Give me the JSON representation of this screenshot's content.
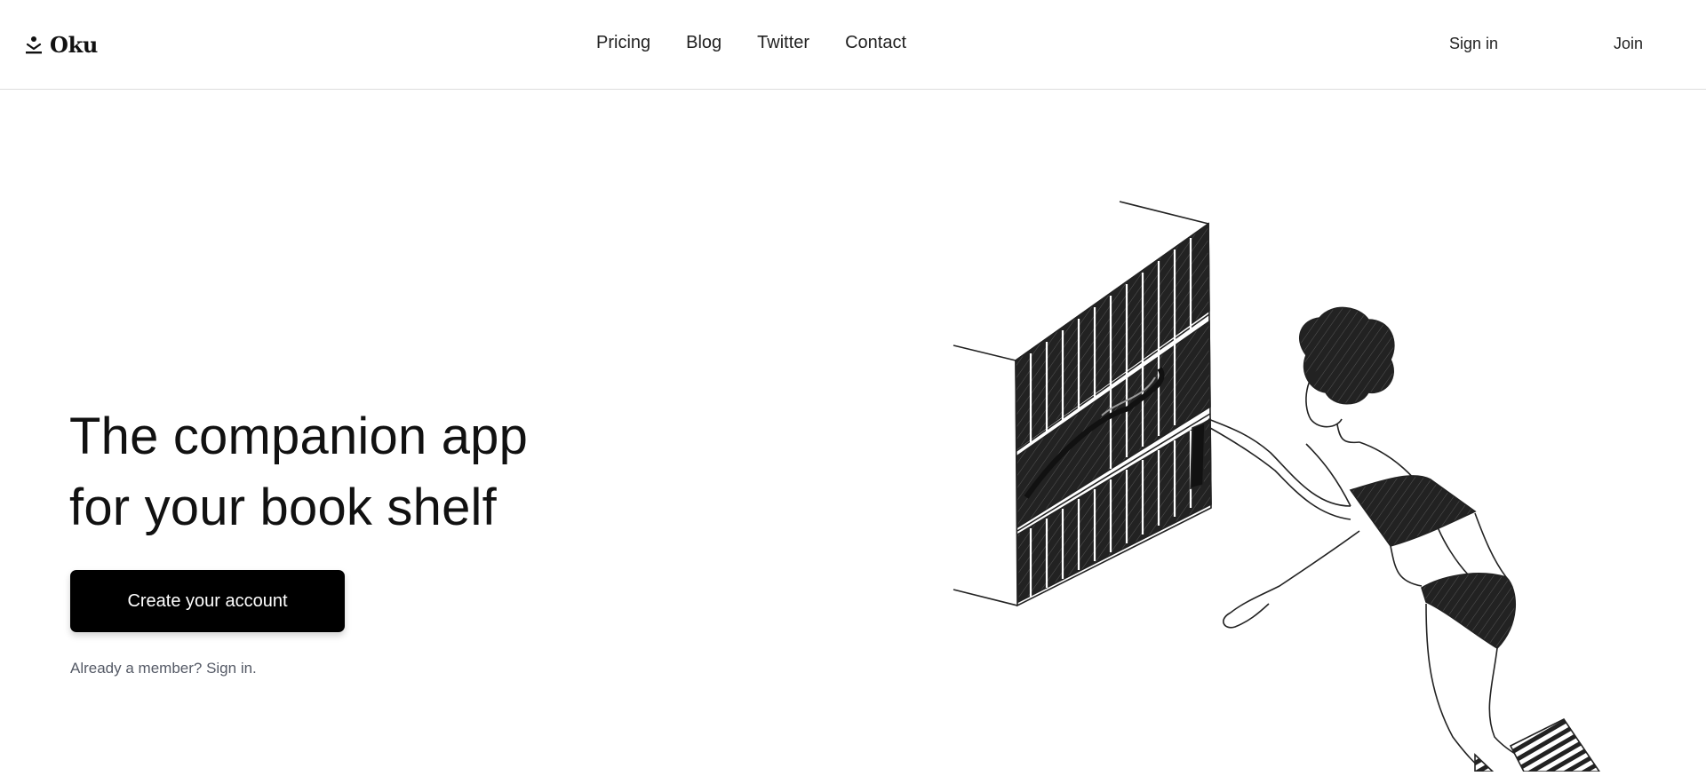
{
  "header": {
    "logo_text": "Oku",
    "logo_icon": "reader-figure-icon",
    "nav": [
      {
        "label": "Pricing"
      },
      {
        "label": "Blog"
      },
      {
        "label": "Twitter"
      },
      {
        "label": "Contact"
      }
    ],
    "sign_in_label": "Sign in",
    "join_label": "Join"
  },
  "hero": {
    "title_line1": "The companion app",
    "title_line2": "for your book shelf",
    "cta_label": "Create your account",
    "member_text": "Already a member? Sign in."
  },
  "colors": {
    "background": "#ffffff",
    "text": "#111111",
    "button_background": "#000000",
    "button_text": "#ffffff",
    "muted_text": "#555a66"
  }
}
